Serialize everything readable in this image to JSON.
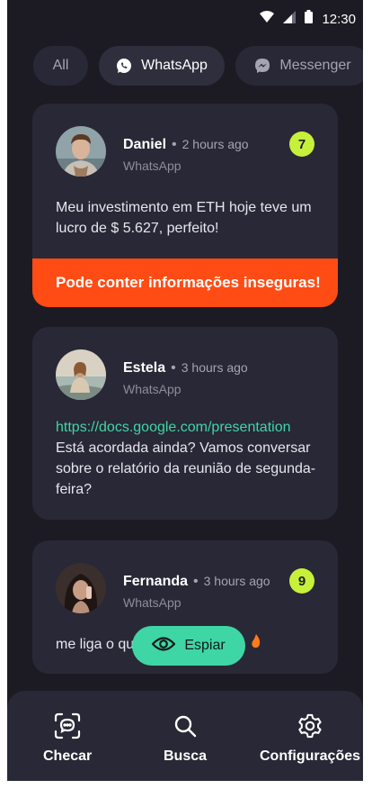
{
  "status_bar": {
    "time": "12:30",
    "icons": [
      "wifi-icon",
      "signal-icon",
      "battery-icon"
    ]
  },
  "filters": [
    {
      "label": "All",
      "active": false
    },
    {
      "label": "WhatsApp",
      "icon": "whatsapp-icon",
      "active": true
    },
    {
      "label": "Messenger",
      "icon": "messenger-icon",
      "active": false
    }
  ],
  "cards": [
    {
      "name": "Daniel",
      "time": "2 hours ago",
      "app": "WhatsApp",
      "badge": "7",
      "message": "Meu investimento em ETH hoje teve um lucro de $ 5.627, perfeito!",
      "warning": "Pode conter informações inseguras!"
    },
    {
      "name": "Estela",
      "time": "3 hours ago",
      "app": "WhatsApp",
      "link": "https://docs.google.com/presentation",
      "message": "Está acordada ainda? Vamos conversar sobre o relatório da reunião de segunda-feira?"
    },
    {
      "name": "Fernanda",
      "time": "3 hours ago",
      "app": "WhatsApp",
      "badge": "9",
      "message": "me liga o qu"
    }
  ],
  "espiar": {
    "label": "Espiar",
    "icon": "eye-icon"
  },
  "bottom_nav": [
    {
      "label": "Checar",
      "icon": "scan-chat-icon"
    },
    {
      "label": "Busca",
      "icon": "search-icon"
    },
    {
      "label": "Configurações",
      "icon": "gear-icon"
    }
  ],
  "colors": {
    "background": "#1c1b24",
    "card": "#292836",
    "accent_green": "#3fd6a5",
    "badge": "#c7f03a",
    "warning": "#ff4c14"
  }
}
